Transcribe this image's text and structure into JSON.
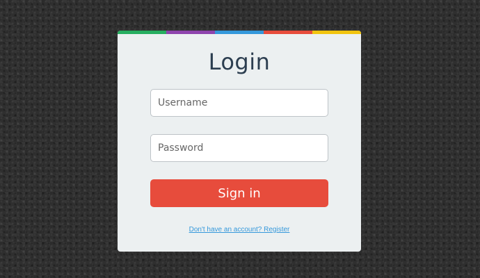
{
  "login": {
    "title": "Login",
    "username_placeholder": "Username",
    "username_value": "",
    "password_placeholder": "Password",
    "password_value": "",
    "signin_label": "Sign in",
    "register_link": "Don't have an account? Register"
  },
  "colors": {
    "top_bar": [
      "#27ae60",
      "#8e44ad",
      "#3498db",
      "#e74c3c",
      "#f1c40f"
    ],
    "button": "#e74c3c",
    "link": "#3498db",
    "card_background": "#ecf0f1",
    "page_background": "#2f2f2f"
  }
}
